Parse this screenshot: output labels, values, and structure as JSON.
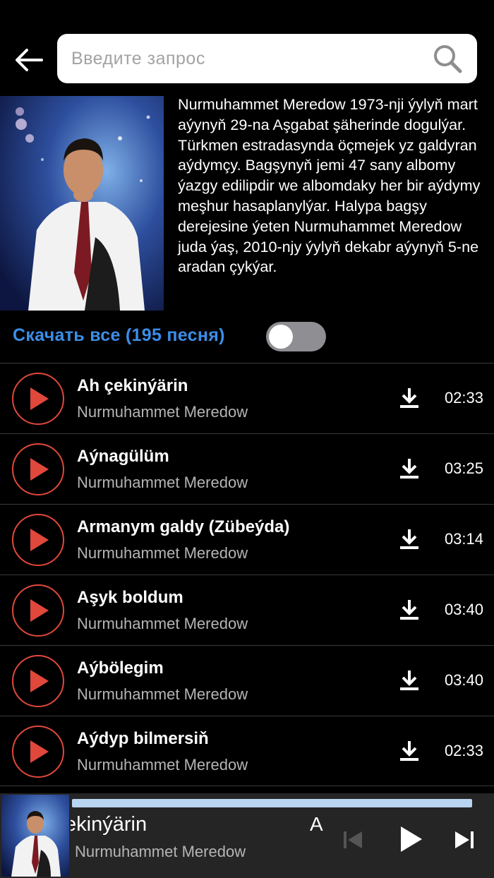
{
  "search": {
    "placeholder": "Введите запрос"
  },
  "icons": {
    "back": "back-arrow-icon",
    "search": "search-icon",
    "play": "play-icon",
    "download": "download-icon",
    "prev": "skip-previous-icon",
    "next": "skip-next-icon"
  },
  "artist": {
    "bio": "Nurmuhammet Meredow 1973-nji ýylyň mart aýynyň 29-na Aşgabat şäherinde dogulýar. Türkmen estradasynda öçmejek yz galdyran aýdymçy. Bagşynyň jemi 47 sany albomy ýazgy edilipdir we albomdaky her bir aýdymy meşhur hasaplanylýar. Halypa bagşy derejesine ýeten Nurmuhammet Meredow juda ýaş, 2010-njy ýylyň dekabr aýynyň 5-ne aradan çykýar."
  },
  "download_all": {
    "label": "Скачать все (195 песня)",
    "enabled": false
  },
  "tracks": [
    {
      "title": "Ah çekinýärin",
      "artist": "Nurmuhammet Meredow",
      "duration": "02:33"
    },
    {
      "title": "Aýnagülüm",
      "artist": "Nurmuhammet Meredow",
      "duration": "03:25"
    },
    {
      "title": "Armanym galdy (Zübeýda)",
      "artist": "Nurmuhammet Meredow",
      "duration": "03:14"
    },
    {
      "title": "Aşyk  boldum",
      "artist": "Nurmuhammet Meredow",
      "duration": "03:40"
    },
    {
      "title": "Aýbölegim",
      "artist": "Nurmuhammet Meredow",
      "duration": "03:40"
    },
    {
      "title": "Aýdyp bilmersiň",
      "artist": "Nurmuhammet Meredow",
      "duration": "02:33"
    }
  ],
  "player": {
    "title": "Ah çekinýärin",
    "title_marquee_tail": "A",
    "artist": "Nurmuhammet Meredow"
  },
  "colors": {
    "accent_blue": "#3c8ee8",
    "play_red": "#e0483b",
    "progress": "#b9d4f1",
    "player_bg": "#252525"
  }
}
